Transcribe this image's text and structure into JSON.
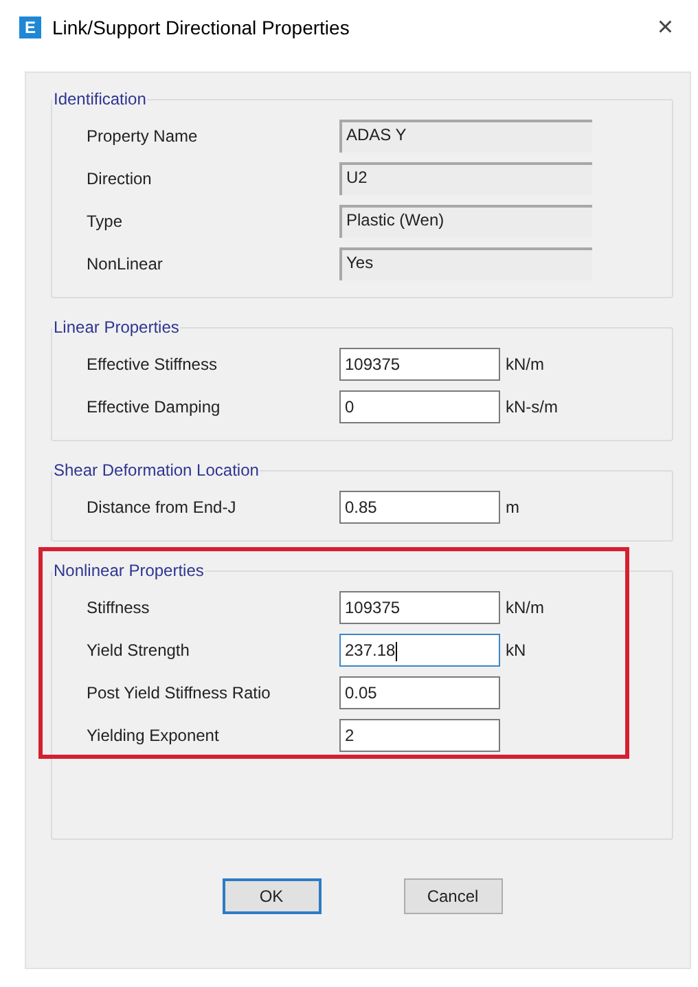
{
  "window": {
    "icon_letter": "E",
    "title": "Link/Support Directional Properties",
    "close": "×"
  },
  "groups": [
    {
      "title": "Identification",
      "highlighted": false,
      "fields": [
        {
          "label": "Property Name",
          "value": "ADAS Y",
          "kind": "readonly"
        },
        {
          "label": "Direction",
          "value": "U2",
          "kind": "readonly"
        },
        {
          "label": "Type",
          "value": "Plastic (Wen)",
          "kind": "readonly"
        },
        {
          "label": "NonLinear",
          "value": "Yes",
          "kind": "readonly"
        }
      ]
    },
    {
      "title": "Linear Properties",
      "highlighted": false,
      "fields": [
        {
          "label": "Effective Stiffness",
          "value": "109375",
          "unit": "kN/m",
          "kind": "input",
          "focused": false
        },
        {
          "label": "Effective Damping",
          "value": "0",
          "unit": "kN-s/m",
          "kind": "input",
          "focused": false
        }
      ]
    },
    {
      "title": "Shear Deformation Location",
      "highlighted": false,
      "fields": [
        {
          "label": "Distance from End-J",
          "value": "0.85",
          "unit": "m",
          "kind": "input",
          "focused": false
        }
      ]
    },
    {
      "title": "Nonlinear Properties",
      "highlighted": true,
      "fields": [
        {
          "label": "Stiffness",
          "value": "109375",
          "unit": "kN/m",
          "kind": "input",
          "focused": false
        },
        {
          "label": "Yield Strength",
          "value": "237.18",
          "unit": "kN",
          "kind": "input",
          "focused": true
        },
        {
          "label": "Post Yield Stiffness Ratio",
          "value": "0.05",
          "kind": "input",
          "focused": false
        },
        {
          "label": "Yielding Exponent",
          "value": "2",
          "kind": "input",
          "focused": false
        }
      ]
    }
  ],
  "buttons": [
    {
      "label": "OK",
      "default": true
    },
    {
      "label": "Cancel",
      "default": false
    }
  ]
}
